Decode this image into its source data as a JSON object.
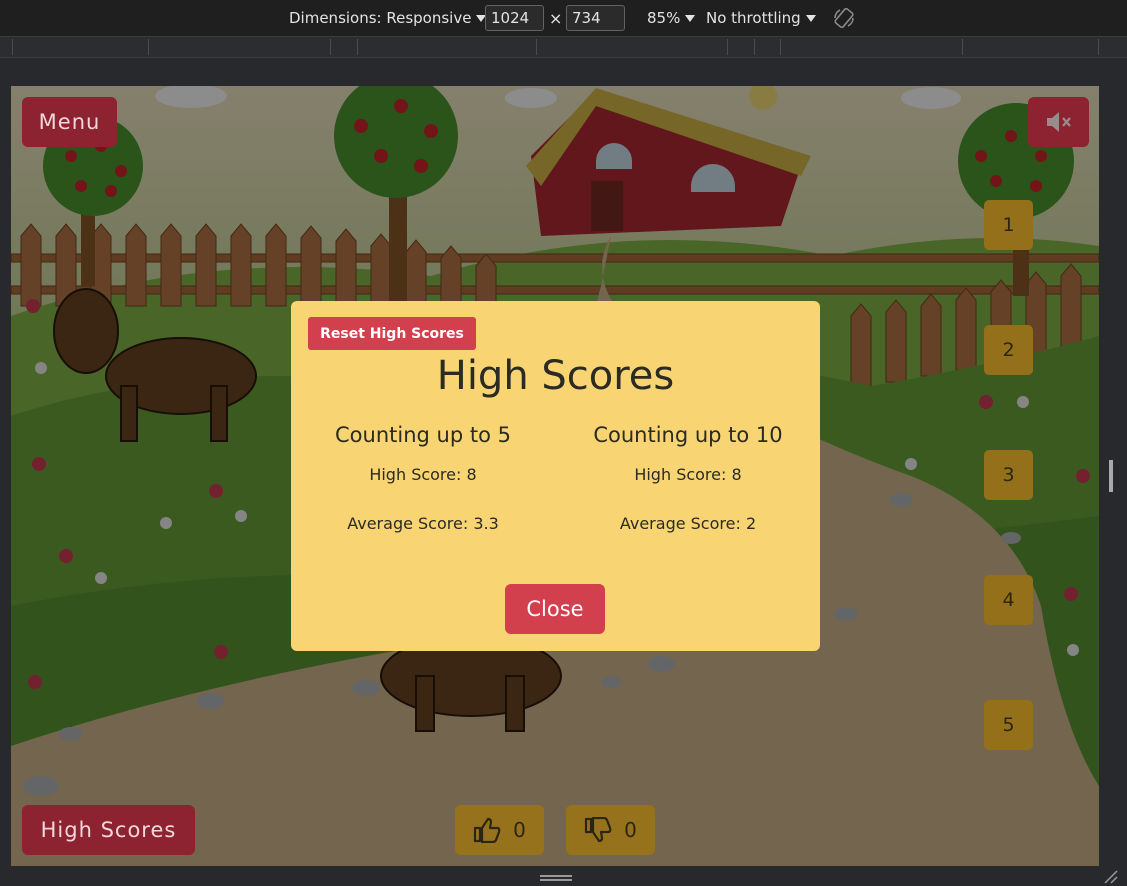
{
  "devtools": {
    "dimensions_label": "Dimensions: Responsive",
    "width_value": "1024",
    "times_sign": "×",
    "height_value": "734",
    "zoom": "85%",
    "throttling": "No throttling"
  },
  "game": {
    "menu_label": "Menu",
    "high_scores_label": "High Scores",
    "mute_icon": "speaker-muted-icon",
    "number_tiles": [
      "1",
      "2",
      "3",
      "4",
      "5"
    ],
    "thumbs_up_count": "0",
    "thumbs_down_count": "0"
  },
  "modal": {
    "reset_label": "Reset High Scores",
    "title": "High Scores",
    "columns": [
      {
        "title": "Counting up to 5",
        "high_score": "High Score: 8",
        "average_score": "Average Score: 3.3"
      },
      {
        "title": "Counting up to 10",
        "high_score": "High Score: 8",
        "average_score": "Average Score: 2"
      }
    ],
    "close_label": "Close"
  },
  "colors": {
    "modal_bg": "#f8d572",
    "accent_red": "#d2404e",
    "dim_button": "#8d2230",
    "tile": "#94701a"
  }
}
